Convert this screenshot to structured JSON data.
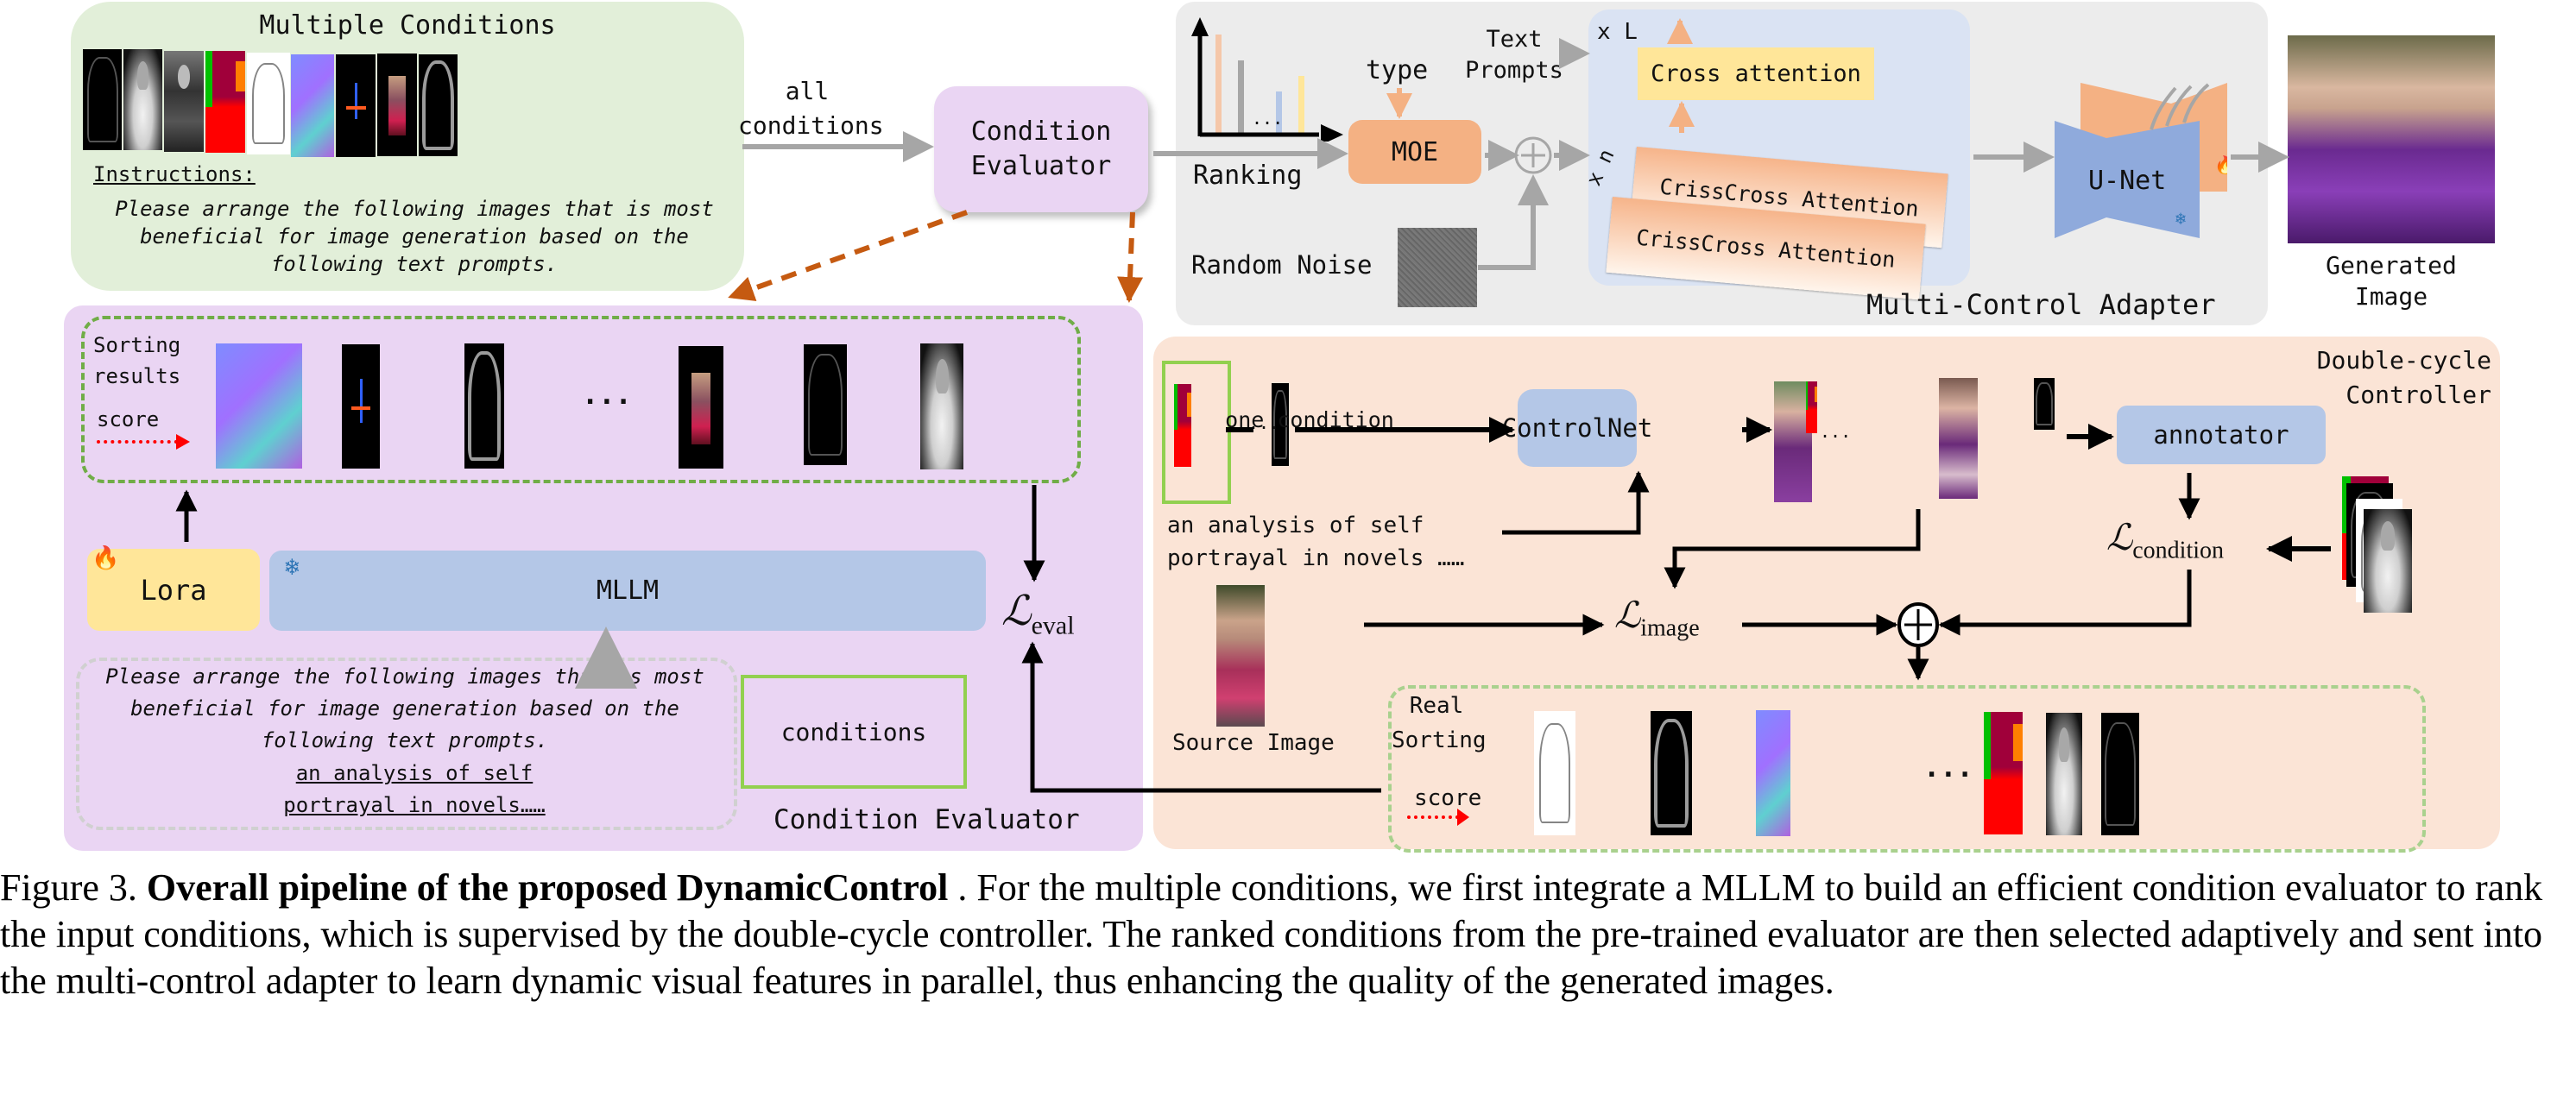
{
  "multiple_conditions": {
    "title": "Multiple Conditions",
    "thumbnails": [
      "canny",
      "depth",
      "grayscale",
      "segmentation",
      "sketch",
      "normal",
      "openpose",
      "photo",
      "hed"
    ],
    "instructions_label": "Instructions:",
    "instructions_text": "Please arrange the following images that is most beneficial for image generation based on the following text prompts."
  },
  "flow": {
    "all_conditions_label": "all conditions",
    "condition_evaluator_box": "Condition Evaluator"
  },
  "adapter": {
    "ranking_label": "Ranking",
    "ranking_ellipsis": "...",
    "ranking_bar_colors": [
      "#f5c7a9",
      "#a6a6a6",
      "#b4c7e7",
      "#ffe699"
    ],
    "type_label": "type",
    "text_prompts_label": "Text Prompts",
    "moe_label": "MOE",
    "random_noise_label": "Random Noise",
    "times_l": "x L",
    "times_n": "x n",
    "cross_attention": "Cross attention",
    "crisscross_1": "CrissCross Attention",
    "crisscross_2": "CrissCross Attention",
    "unet_label": "U-Net",
    "panel_title": "Multi-Control Adapter",
    "generated_label": "Generated Image"
  },
  "evaluator": {
    "sorting_label": "Sorting results",
    "score_label": "score",
    "ellipsis": "...",
    "sorted_thumbnails": [
      "normal",
      "openpose",
      "hed",
      "photo",
      "canny",
      "depth"
    ],
    "lora_label": "Lora",
    "mllm_label": "MLLM",
    "loss_eval": "ℒ",
    "loss_eval_sub": "eval",
    "prompt_text": "Please arrange the following images that is most beneficial for image generation based on the following text prompts.",
    "prompt_example": "an analysis of self portrayal in novels……",
    "conditions_box": "conditions",
    "panel_title": "Condition Evaluator"
  },
  "controller": {
    "panel_title": "Double-cycle Controller",
    "ellipsis": "...",
    "one_condition_label": "one condition",
    "controlnet_label": "ControlNet",
    "annotator_label": "annotator",
    "text_prompt": "an analysis of self portrayal in novels ……",
    "loss_condition": "ℒ",
    "loss_condition_sub": "condition",
    "loss_image": "ℒ",
    "loss_image_sub": "image",
    "source_image_label": "Source Image",
    "real_sorting_label": "Real Sorting",
    "score_label": "score",
    "real_sorted_thumbnails": [
      "sketch",
      "hed",
      "normal",
      "segmentation",
      "depth",
      "canny"
    ]
  },
  "caption": {
    "figure_label": "Figure 3.",
    "bold_title": "Overall pipeline of the proposed DynamicControl",
    "body": " .  For the multiple conditions, we first integrate a MLLM to build an efficient condition evaluator to rank the input conditions, which is supervised by the double-cycle controller. The ranked conditions from the pre-trained evaluator are then selected adaptively and sent into the multi-control adapter to learn dynamic visual features in parallel, thus enhancing the quality of the generated images."
  },
  "colors": {
    "green_panel": "#e2efd9",
    "purple_panel": "#ead5f3",
    "gray_panel": "#ececec",
    "peach_panel": "#fbe4d6",
    "blue_box": "#b4c7e7",
    "orange_box": "#f4b183",
    "yellow_box": "#ffe699",
    "dash_orange": "#c55a11",
    "dash_green": "#70ad47",
    "score_red": "#ff0000"
  }
}
